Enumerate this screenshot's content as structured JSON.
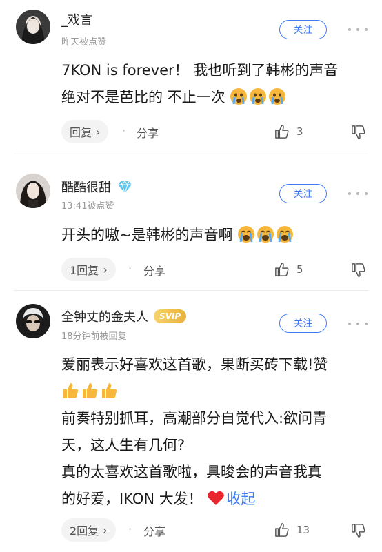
{
  "comments": [
    {
      "username": "_戏言",
      "meta": "昨天被点赞",
      "follow_label": "关注",
      "lines": [
        "7KON is forever！ 我也听到了韩彬的声音",
        "绝对不是芭比的 不止一次"
      ],
      "reply_label": "回复",
      "reply_chevron": "›",
      "share_label": "分享",
      "like_count": "3",
      "emoji": "crying-face"
    },
    {
      "username": "酷酷很甜",
      "badge": "diamond-icon",
      "meta": "13:41被点赞",
      "follow_label": "关注",
      "lines": [
        "开头的嗷~是韩彬的声音啊"
      ],
      "reply_label": "1回复",
      "reply_chevron": "›",
      "share_label": "分享",
      "like_count": "5",
      "emoji": "loudly-crying-face"
    },
    {
      "username": "全钟丈的金夫人",
      "badge_text": "SVIP",
      "meta": "18分钟前被回复",
      "follow_label": "关注",
      "lines": [
        "爱丽表示好喜欢这首歌，果断买砖下载!赞",
        "前奏特别抓耳，高潮部分自觉代入:欲问青",
        "天，这人生有几何?",
        "真的太喜欢这首歌啦，具晙会的声音我真",
        "的好爱，IKON 大发！"
      ],
      "collapse_label": "收起",
      "reply_label": "2回复",
      "reply_chevron": "›",
      "share_label": "分享",
      "like_count": "13",
      "emoji": "thumbs-up"
    }
  ],
  "separator_dot": "·",
  "colors": {
    "accent": "#3d7af5",
    "meta": "#999999",
    "heart": "#e8262e",
    "emoji": "#f6b73c"
  }
}
